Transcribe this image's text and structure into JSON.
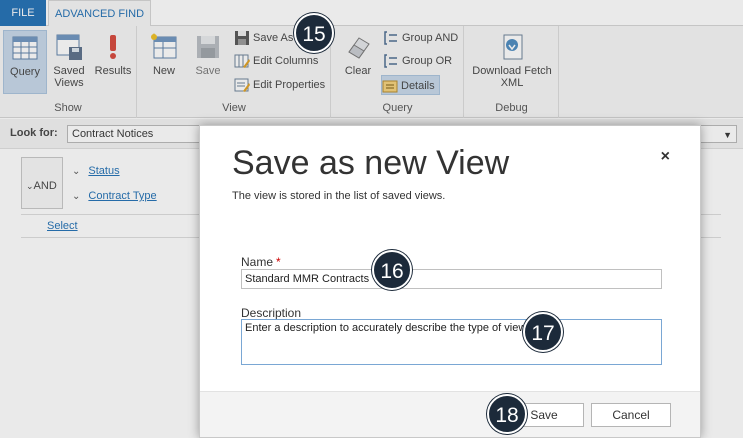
{
  "tabs": {
    "file": "FILE",
    "advanced_find": "ADVANCED FIND"
  },
  "ribbon": {
    "show_group": {
      "label": "Show",
      "query": "Query",
      "saved_views": "Saved Views",
      "results": "Results"
    },
    "view_group": {
      "label": "View",
      "new": "New",
      "save": "Save",
      "save_as": "Save As",
      "edit_columns": "Edit Columns",
      "edit_properties": "Edit Properties"
    },
    "query_group": {
      "label": "Query",
      "clear": "Clear",
      "group_and": "Group AND",
      "group_or": "Group OR",
      "details": "Details"
    },
    "debug_group": {
      "label": "Debug",
      "download_fetch_xml": "Download Fetch XML"
    }
  },
  "lookfor": {
    "label": "Look for:",
    "value": "Contract Notices"
  },
  "criteria": {
    "operator": "AND",
    "rows": [
      "Status",
      "Contract Type"
    ],
    "select_link": "Select"
  },
  "dialog": {
    "title": "Save as new View",
    "subtitle": "The view is stored in the list of saved views.",
    "name_label": "Name",
    "required_mark": "*",
    "name_value": "Standard MMR Contracts",
    "description_label": "Description",
    "description_value": "Enter a description to accurately describe the type of view",
    "save_button": "Save",
    "cancel_button": "Cancel",
    "close_glyph": "×"
  },
  "badges": {
    "b15": "15",
    "b16": "16",
    "b17": "17",
    "b18": "18"
  },
  "colors": {
    "accent": "#1f6fb4",
    "badge": "#1c2a3a"
  },
  "icons": [
    "query-icon",
    "saved-views-icon",
    "results-icon",
    "new-icon",
    "save-icon",
    "save-as-icon",
    "edit-columns-icon",
    "edit-properties-icon",
    "clear-icon",
    "group-and-icon",
    "group-or-icon",
    "details-icon",
    "download-fetch-xml-icon",
    "close-icon"
  ]
}
